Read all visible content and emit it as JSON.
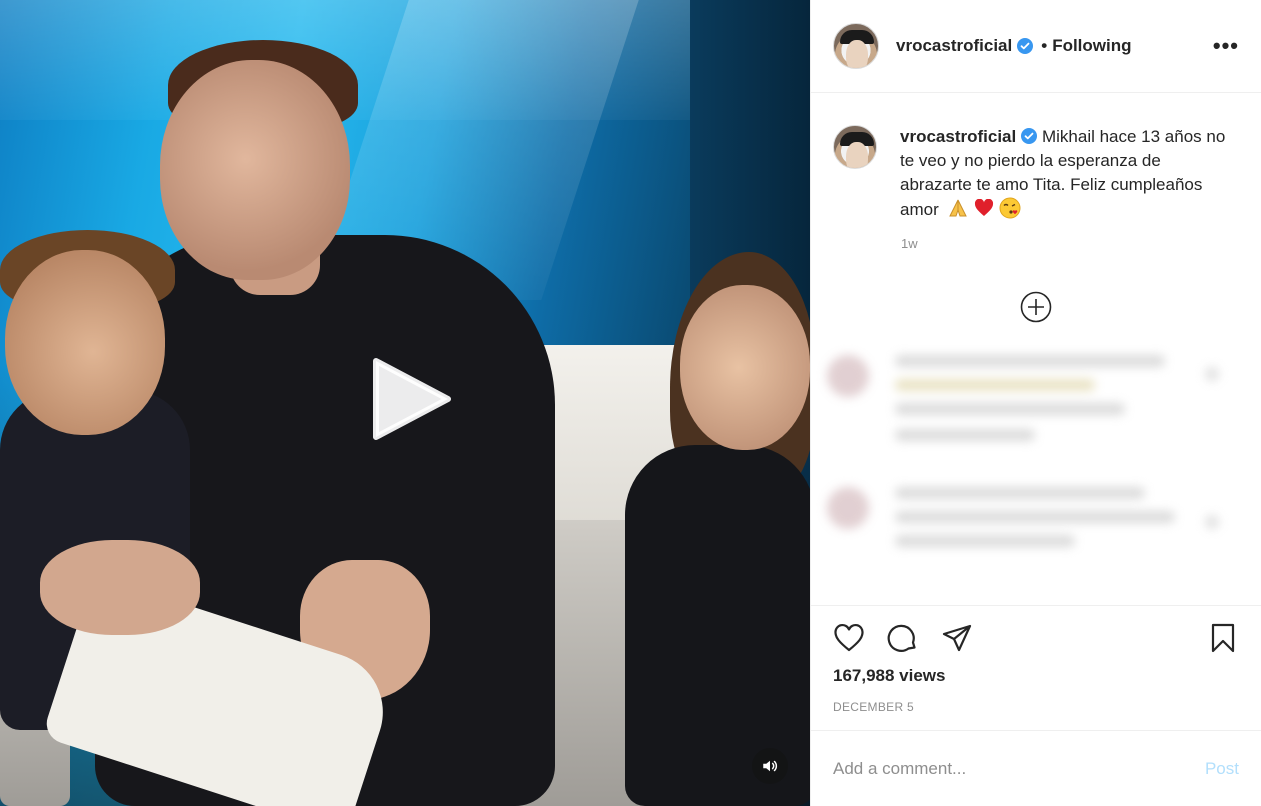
{
  "colors": {
    "accent": "#0095f6",
    "verified": "#3897f0",
    "muted": "#8e8e8e",
    "post_disabled": "#b2dffc",
    "heart": "#ed1c24"
  },
  "video": {
    "play_icon": "play-icon",
    "mute_icon": "speaker-icon"
  },
  "header": {
    "username": "vrocastroficial",
    "separator": "•",
    "follow_status": "Following",
    "more_icon": "more-options-icon",
    "more_label": "•••"
  },
  "caption": {
    "username": "vrocastroficial",
    "text": "Mikhail hace 13 años no te veo y no pierdo la esperanza de abrazarte te amo Tita. Feliz cumpleaños amor",
    "emojis": [
      "folded-hands-emoji",
      "red-heart-emoji",
      "face-blowing-kiss-emoji"
    ],
    "time": "1w"
  },
  "load_more_icon": "plus-circle-icon",
  "actions": {
    "like_icon": "heart-icon",
    "comment_icon": "comment-icon",
    "share_icon": "share-icon",
    "save_icon": "bookmark-icon",
    "views": "167,988 views",
    "date": "DECEMBER 5"
  },
  "comment_box": {
    "placeholder": "Add a comment...",
    "post_label": "Post"
  }
}
